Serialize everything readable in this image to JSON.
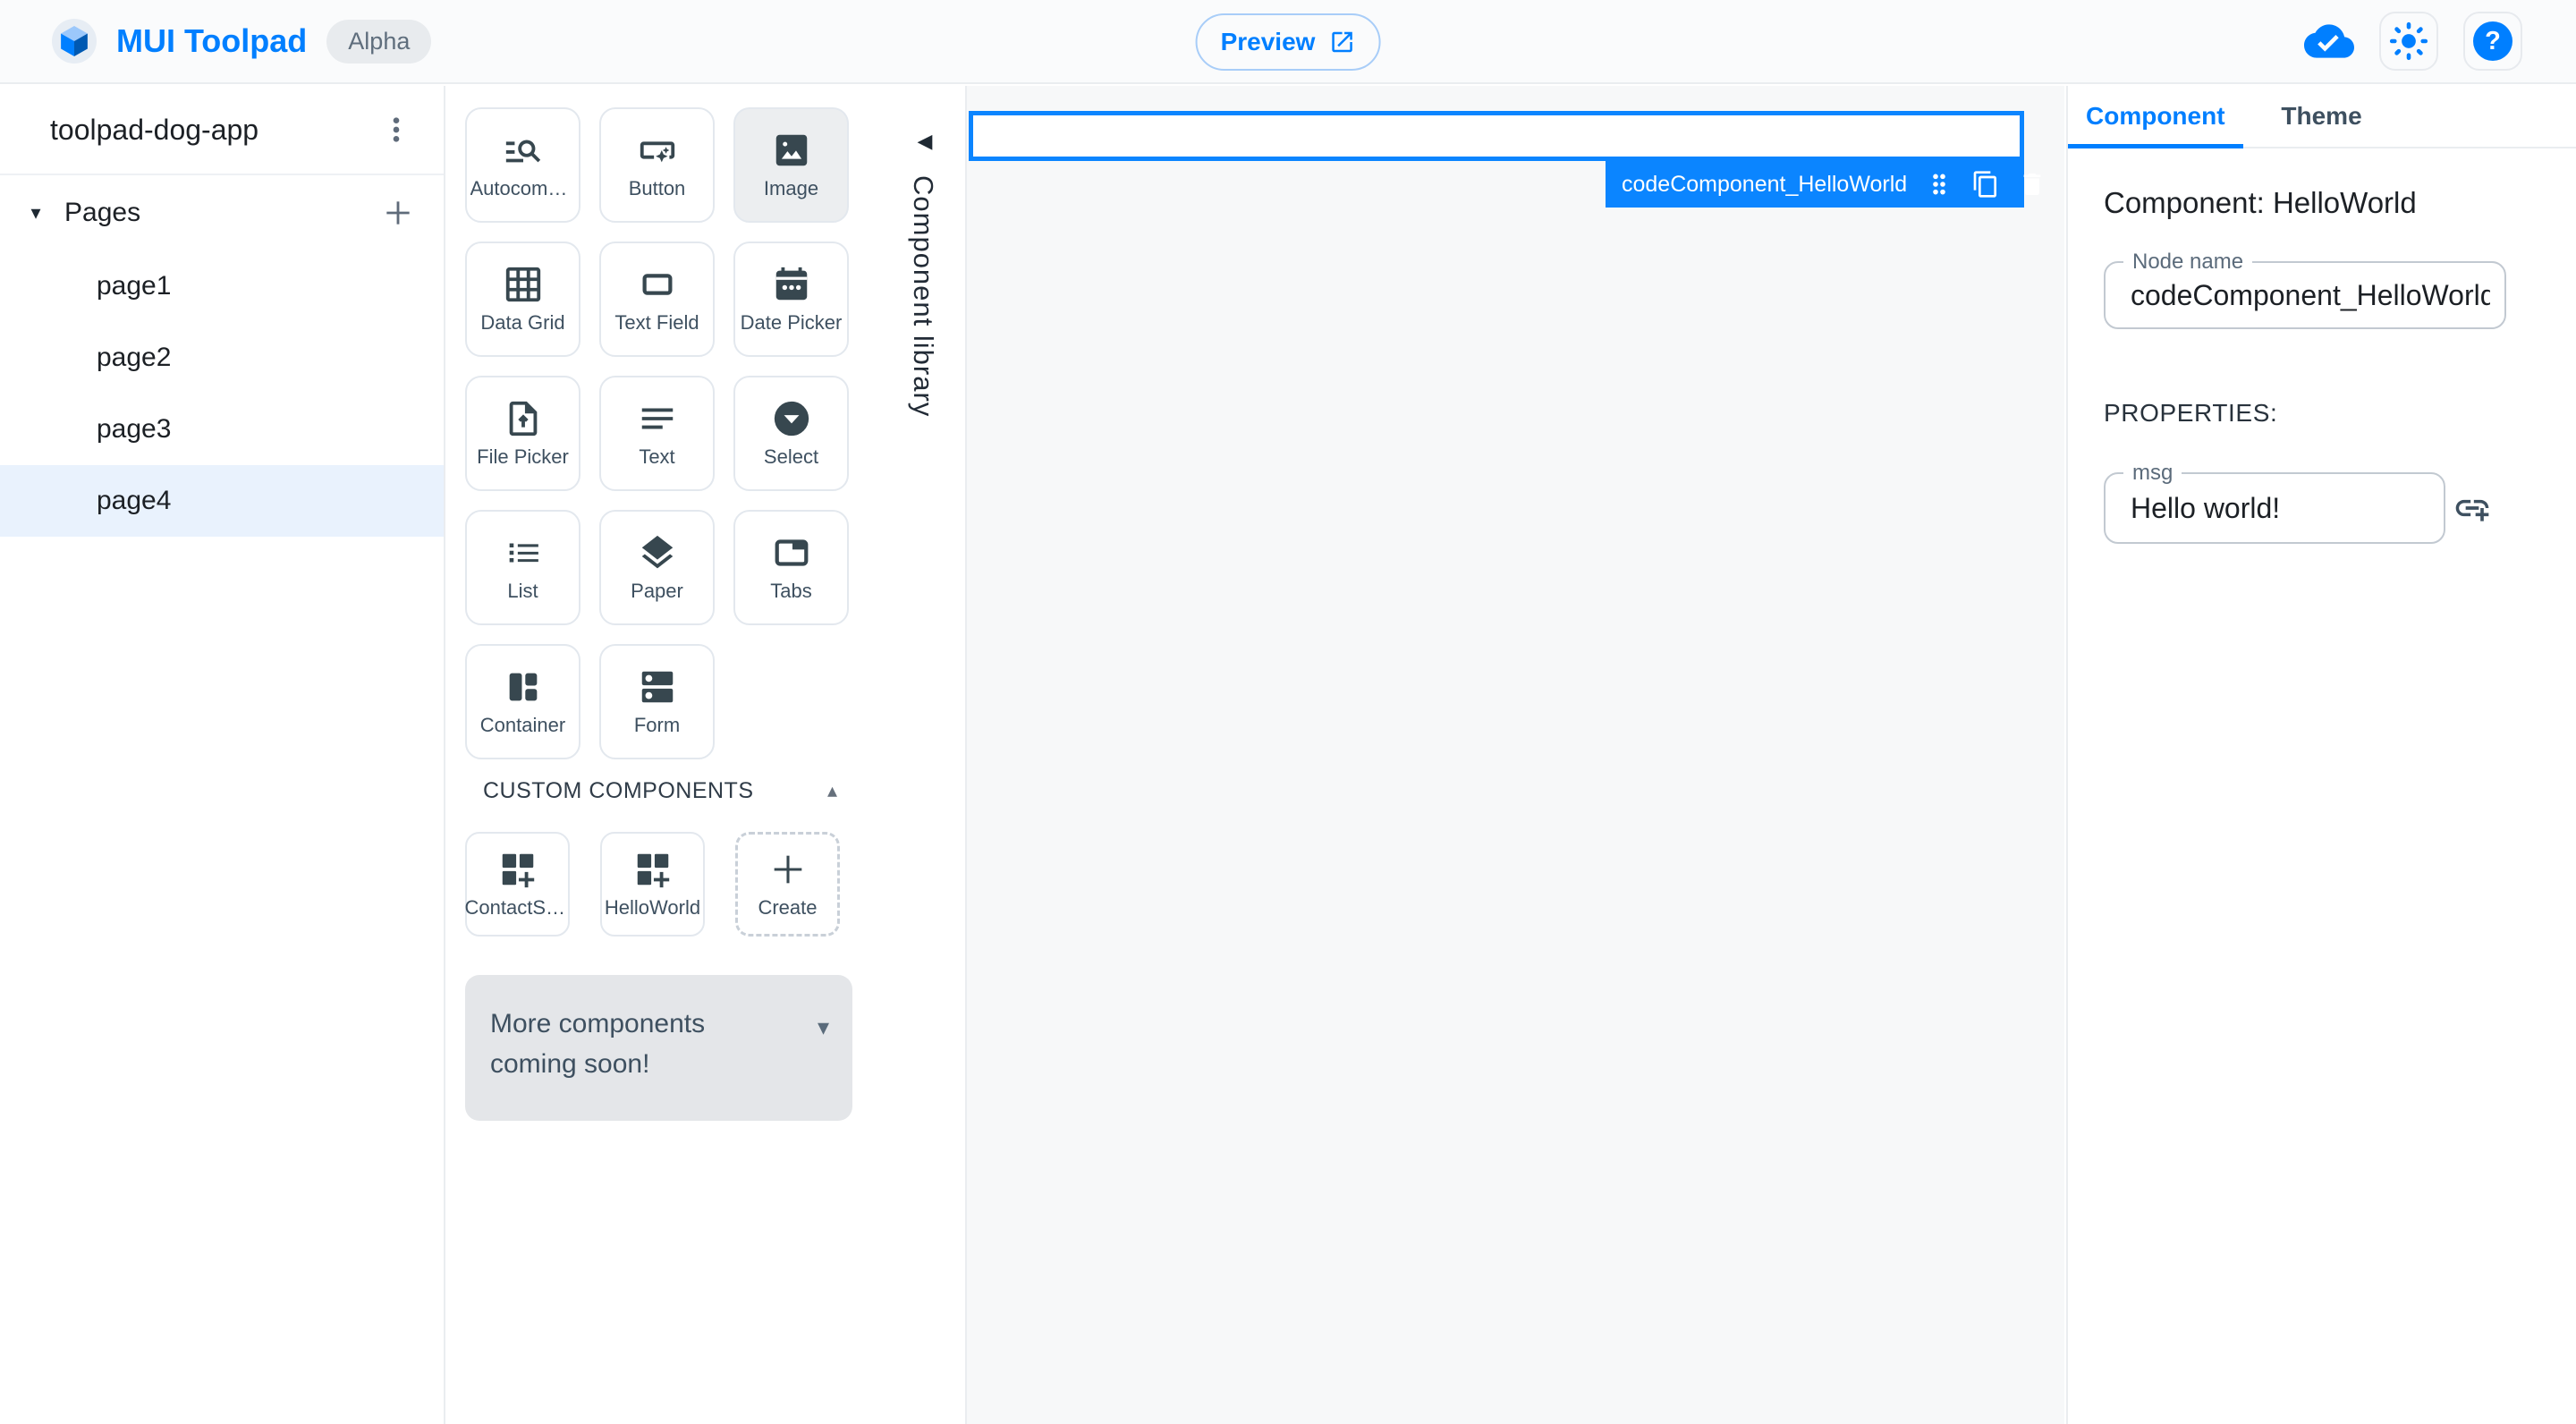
{
  "header": {
    "app_title": "MUI Toolpad",
    "badge": "Alpha",
    "preview_label": "Preview",
    "help_glyph": "?",
    "accent_color": "#007FFF"
  },
  "sidebar": {
    "project_name": "toolpad-dog-app",
    "pages_label": "Pages",
    "pages": [
      {
        "label": "page1",
        "active": false
      },
      {
        "label": "page2",
        "active": false
      },
      {
        "label": "page3",
        "active": false
      },
      {
        "label": "page4",
        "active": true
      }
    ]
  },
  "library": {
    "panel_label": "Component library",
    "tiles": [
      {
        "label": "Autocomplete",
        "icon": "manage-search-icon"
      },
      {
        "label": "Button",
        "icon": "smart-button-icon"
      },
      {
        "label": "Image",
        "icon": "image-icon",
        "state": "active"
      },
      {
        "label": "Data Grid",
        "icon": "grid-icon"
      },
      {
        "label": "Text Field",
        "icon": "text-field-icon"
      },
      {
        "label": "Date Picker",
        "icon": "calendar-icon"
      },
      {
        "label": "File Picker",
        "icon": "upload-file-icon"
      },
      {
        "label": "Text",
        "icon": "notes-icon"
      },
      {
        "label": "Select",
        "icon": "dropdown-circle-icon"
      },
      {
        "label": "List",
        "icon": "list-icon"
      },
      {
        "label": "Paper",
        "icon": "layers-icon"
      },
      {
        "label": "Tabs",
        "icon": "tab-icon"
      },
      {
        "label": "Container",
        "icon": "container-icon"
      },
      {
        "label": "Form",
        "icon": "form-icon"
      }
    ],
    "custom_section": {
      "title": "CUSTOM COMPONENTS",
      "tiles": [
        {
          "label": "ContactSta…",
          "icon": "dashboard-customize-icon"
        },
        {
          "label": "HelloWorld",
          "icon": "dashboard-customize-icon"
        }
      ],
      "create_label": "Create"
    },
    "more_note": "More components coming soon!",
    "glyphs": {
      "pages_caret": "▾",
      "custom_collapse_caret": "▴",
      "more_caret": "▾",
      "collapse_library_arrow": "◀"
    }
  },
  "canvas": {
    "selection_label": "codeComponent_HelloWorld"
  },
  "inspector": {
    "tabs": [
      "Component",
      "Theme"
    ],
    "active_tab": "Component",
    "heading": "Component: HelloWorld",
    "node_name": {
      "label": "Node name",
      "value": "codeComponent_HelloWorld"
    },
    "properties_label": "PROPERTIES:",
    "msg": {
      "label": "msg",
      "value": "Hello world!"
    }
  }
}
